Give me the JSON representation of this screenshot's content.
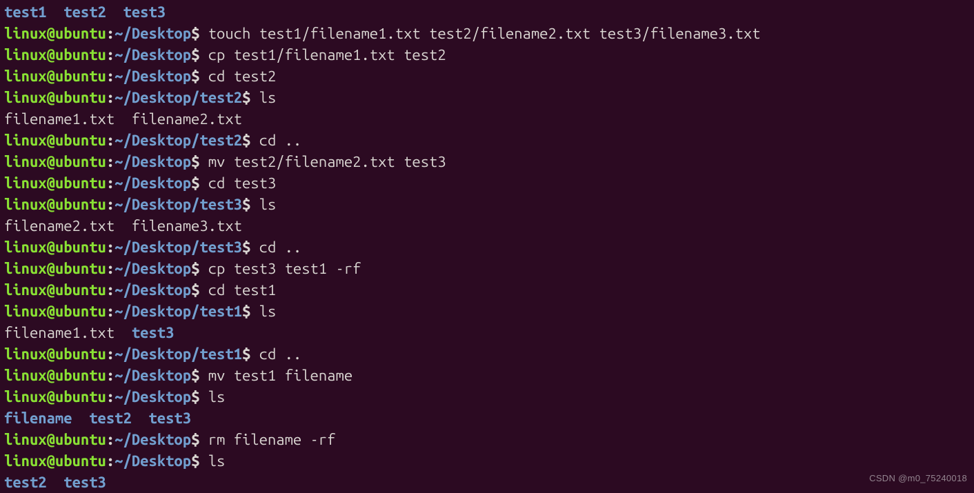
{
  "watermark": "CSDN @m0_75240018",
  "lines": [
    {
      "type": "out",
      "segments": [
        {
          "cls": "dir",
          "text": "test1"
        },
        {
          "cls": "out",
          "text": "  "
        },
        {
          "cls": "dir",
          "text": "test2"
        },
        {
          "cls": "out",
          "text": "  "
        },
        {
          "cls": "dir",
          "text": "test3"
        }
      ]
    },
    {
      "type": "prompt",
      "user": "linux@ubuntu",
      "path": "~/Desktop",
      "cmd": "touch test1/filename1.txt test2/filename2.txt test3/filename3.txt"
    },
    {
      "type": "prompt",
      "user": "linux@ubuntu",
      "path": "~/Desktop",
      "cmd": "cp test1/filename1.txt test2"
    },
    {
      "type": "prompt",
      "user": "linux@ubuntu",
      "path": "~/Desktop",
      "cmd": "cd test2"
    },
    {
      "type": "prompt",
      "user": "linux@ubuntu",
      "path": "~/Desktop/test2",
      "cmd": "ls"
    },
    {
      "type": "out",
      "segments": [
        {
          "cls": "out",
          "text": "filename1.txt  filename2.txt"
        }
      ]
    },
    {
      "type": "prompt",
      "user": "linux@ubuntu",
      "path": "~/Desktop/test2",
      "cmd": "cd .."
    },
    {
      "type": "prompt",
      "user": "linux@ubuntu",
      "path": "~/Desktop",
      "cmd": "mv test2/filename2.txt test3"
    },
    {
      "type": "prompt",
      "user": "linux@ubuntu",
      "path": "~/Desktop",
      "cmd": "cd test3"
    },
    {
      "type": "prompt",
      "user": "linux@ubuntu",
      "path": "~/Desktop/test3",
      "cmd": "ls"
    },
    {
      "type": "out",
      "segments": [
        {
          "cls": "out",
          "text": "filename2.txt  filename3.txt"
        }
      ]
    },
    {
      "type": "prompt",
      "user": "linux@ubuntu",
      "path": "~/Desktop/test3",
      "cmd": "cd .."
    },
    {
      "type": "prompt",
      "user": "linux@ubuntu",
      "path": "~/Desktop",
      "cmd": "cp test3 test1 -rf"
    },
    {
      "type": "prompt",
      "user": "linux@ubuntu",
      "path": "~/Desktop",
      "cmd": "cd test1"
    },
    {
      "type": "prompt",
      "user": "linux@ubuntu",
      "path": "~/Desktop/test1",
      "cmd": "ls"
    },
    {
      "type": "out",
      "segments": [
        {
          "cls": "out",
          "text": "filename1.txt  "
        },
        {
          "cls": "dir",
          "text": "test3"
        }
      ]
    },
    {
      "type": "prompt",
      "user": "linux@ubuntu",
      "path": "~/Desktop/test1",
      "cmd": "cd .."
    },
    {
      "type": "prompt",
      "user": "linux@ubuntu",
      "path": "~/Desktop",
      "cmd": "mv test1 filename"
    },
    {
      "type": "prompt",
      "user": "linux@ubuntu",
      "path": "~/Desktop",
      "cmd": "ls"
    },
    {
      "type": "out",
      "segments": [
        {
          "cls": "dir",
          "text": "filename"
        },
        {
          "cls": "out",
          "text": "  "
        },
        {
          "cls": "dir",
          "text": "test2"
        },
        {
          "cls": "out",
          "text": "  "
        },
        {
          "cls": "dir",
          "text": "test3"
        }
      ]
    },
    {
      "type": "prompt",
      "user": "linux@ubuntu",
      "path": "~/Desktop",
      "cmd": "rm filename -rf"
    },
    {
      "type": "prompt",
      "user": "linux@ubuntu",
      "path": "~/Desktop",
      "cmd": "ls"
    },
    {
      "type": "out",
      "segments": [
        {
          "cls": "dir",
          "text": "test2"
        },
        {
          "cls": "out",
          "text": "  "
        },
        {
          "cls": "dir",
          "text": "test3"
        }
      ]
    }
  ]
}
